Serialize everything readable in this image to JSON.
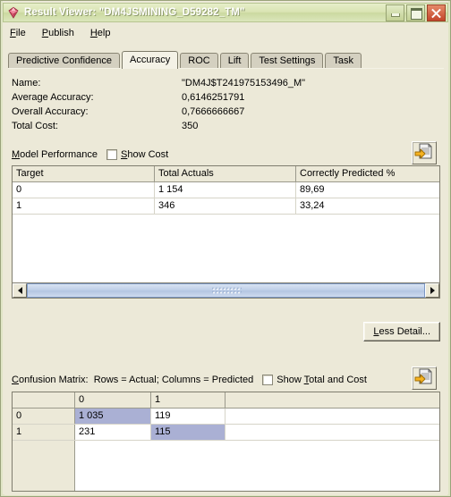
{
  "window": {
    "title": "Result Viewer: \"DM4JSMINING_D59282_TM\"",
    "app_icon": "gem-icon",
    "controls": {
      "minimize": "minimize-icon",
      "maximize": "maximize-icon",
      "close": "close-icon"
    },
    "colors": {
      "titlebar": "#d9e3b2",
      "face": "#ece9d8",
      "highlight_cell": "#aab0d4",
      "close_button": "#c3452a",
      "scrollbar_thumb": "#b4c6e2"
    }
  },
  "menu": {
    "items": [
      {
        "label": "File",
        "accel": "F"
      },
      {
        "label": "Publish",
        "accel": "P"
      },
      {
        "label": "Help",
        "accel": "H"
      }
    ]
  },
  "tabs": {
    "items": [
      {
        "label": "Predictive Confidence",
        "active": false
      },
      {
        "label": "Accuracy",
        "active": true
      },
      {
        "label": "ROC",
        "active": false
      },
      {
        "label": "Lift",
        "active": false
      },
      {
        "label": "Test Settings",
        "active": false
      },
      {
        "label": "Task",
        "active": false
      }
    ]
  },
  "summary": {
    "rows": [
      {
        "label": "Name:",
        "value": "\"DM4J$T241975153496_M\""
      },
      {
        "label": "Average Accuracy:",
        "value": "0,6146251791"
      },
      {
        "label": "Overall Accuracy:",
        "value": "0,7666666667"
      },
      {
        "label": "Total Cost:",
        "value": "350"
      }
    ]
  },
  "model_performance": {
    "title": "Model Performance",
    "title_accel": "M",
    "show_cost_label": "Show Cost",
    "show_cost_accel": "S",
    "show_cost_checked": false,
    "export_icon": "export-document-icon",
    "columns": [
      "Target",
      "Total Actuals",
      "Correctly Predicted %"
    ],
    "rows": [
      [
        "0",
        "1 154",
        "89,69"
      ],
      [
        "1",
        "346",
        "33,24"
      ]
    ]
  },
  "detail_button": {
    "label": "Less Detail...",
    "accel": "L"
  },
  "confusion_matrix": {
    "title": "Confusion Matrix:  Rows = Actual; Columns = Predicted",
    "title_accel": "C",
    "show_total_label": "Show Total and Cost",
    "show_total_accel": "T",
    "show_total_checked": false,
    "export_icon": "export-document-icon",
    "corner_label": "",
    "columns": [
      "0",
      "1"
    ],
    "row_headers": [
      "0",
      "1"
    ],
    "cells": [
      [
        "1 035",
        "119"
      ],
      [
        "231",
        "115"
      ]
    ],
    "highlight_diagonal": true
  },
  "scrollbars": {
    "left_arrow": "triangle-left-icon",
    "right_arrow": "triangle-right-icon",
    "grip": "scrollbar-grip"
  }
}
